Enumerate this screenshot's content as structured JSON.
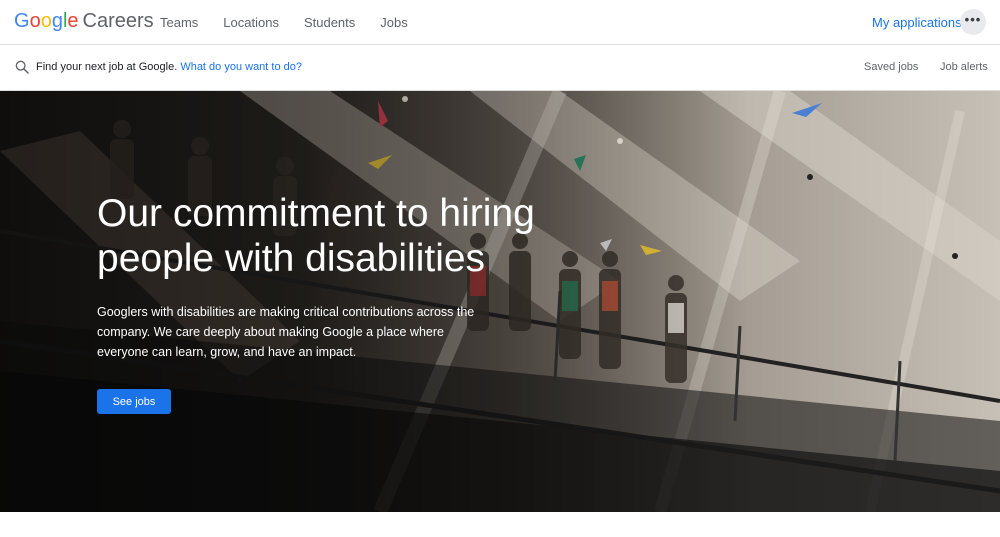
{
  "header": {
    "logo_letters": [
      {
        "char": "G",
        "color": "#4285f4"
      },
      {
        "char": "o",
        "color": "#ea4335"
      },
      {
        "char": "o",
        "color": "#fbbc05"
      },
      {
        "char": "g",
        "color": "#4285f4"
      },
      {
        "char": "l",
        "color": "#34a853"
      },
      {
        "char": "e",
        "color": "#ea4335"
      }
    ],
    "logo_suffix": "Careers",
    "nav": {
      "teams": "Teams",
      "locations": "Locations",
      "students": "Students",
      "jobs": "Jobs"
    },
    "my_applications": "My applications",
    "more_icon": "more-horizontal-icon"
  },
  "search": {
    "icon": "search-icon",
    "lead_text": "Find your next job at Google.",
    "prompt_text": "What do you want to do?",
    "saved_jobs": "Saved jobs",
    "job_alerts": "Job alerts"
  },
  "hero": {
    "title": "Our commitment to hiring people with disabilities",
    "description": "Googlers with disabilities are making critical contributions across the company. We care deeply about making Google a place where everyone can learn, grow, and have an impact.",
    "cta": "See jobs"
  },
  "colors": {
    "accent": "#1a73e8",
    "text_muted": "#5f6368"
  }
}
